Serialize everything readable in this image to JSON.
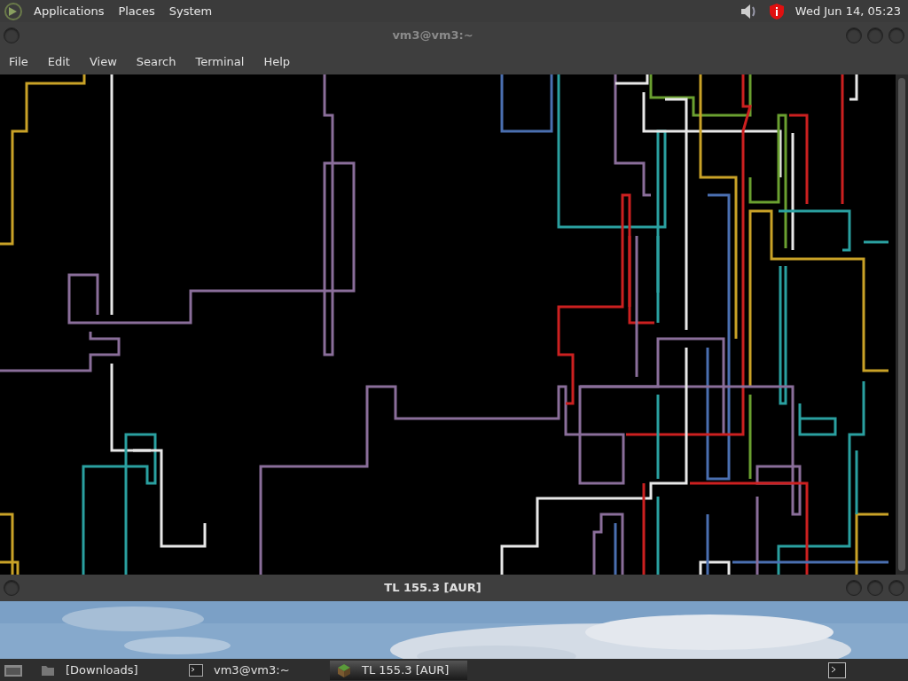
{
  "top_panel": {
    "menus": [
      "Applications",
      "Places",
      "System"
    ],
    "clock": "Wed Jun 14, 05:23"
  },
  "terminal_window": {
    "title": "vm3@vm3:~",
    "menu": [
      "File",
      "Edit",
      "View",
      "Search",
      "Terminal",
      "Help"
    ]
  },
  "second_window": {
    "title": "TL 155.3 [AUR]"
  },
  "taskbar": {
    "tasks": [
      {
        "label": "[Downloads]",
        "kind": "folder",
        "selected": false
      },
      {
        "label": "vm3@vm3:~",
        "kind": "terminal",
        "selected": false
      },
      {
        "label": "TL 155.3 [AUR]",
        "kind": "game",
        "selected": true
      }
    ]
  }
}
